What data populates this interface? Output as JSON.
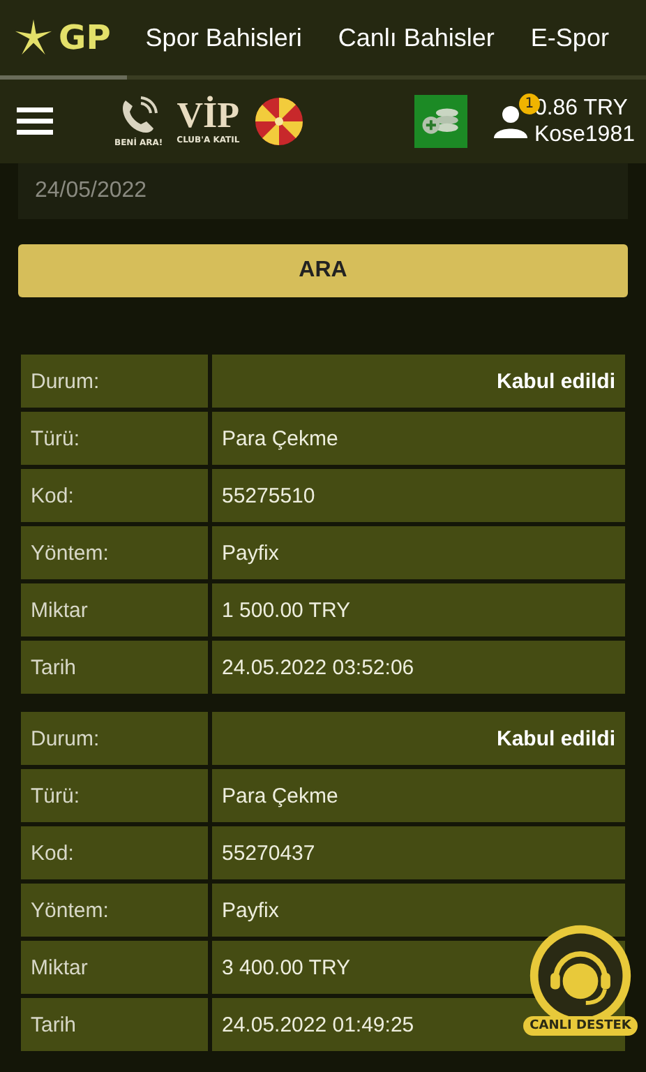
{
  "nav": {
    "logo": "GP",
    "tabs": [
      {
        "label": "Spor Bahisleri",
        "selected": false
      },
      {
        "label": "Canlı Bahisler",
        "selected": false
      },
      {
        "label": "E-Spor",
        "selected": false
      }
    ],
    "logo_selected": true
  },
  "header": {
    "call_label": "BENİ ARA!",
    "vip_label": "VİP",
    "vip_caption": "CLUB'A KATIL",
    "notification_count": "1",
    "balance": "0.86 TRY",
    "username": "Kose1981"
  },
  "date_field": {
    "value": "24/05/2022"
  },
  "search_button": "ARA",
  "records": [
    {
      "rows": [
        {
          "kind": "status",
          "label": "Durum:",
          "value": "Kabul edildi"
        },
        {
          "kind": "plain",
          "label": "Türü:",
          "value": "Para Çekme"
        },
        {
          "kind": "plain",
          "label": "Kod:",
          "value": "55275510"
        },
        {
          "kind": "plain",
          "label": "Yöntem:",
          "value": "Payfix"
        },
        {
          "kind": "plain",
          "label": "Miktar",
          "value": "1 500.00 TRY"
        },
        {
          "kind": "plain",
          "label": "Tarih",
          "value": "24.05.2022 03:52:06"
        }
      ]
    },
    {
      "rows": [
        {
          "kind": "status",
          "label": "Durum:",
          "value": "Kabul edildi"
        },
        {
          "kind": "plain",
          "label": "Türü:",
          "value": "Para Çekme"
        },
        {
          "kind": "plain",
          "label": "Kod:",
          "value": "55270437"
        },
        {
          "kind": "plain",
          "label": "Yöntem:",
          "value": "Payfix"
        },
        {
          "kind": "plain",
          "label": "Miktar",
          "value": "3 400.00 TRY"
        },
        {
          "kind": "plain",
          "label": "Tarih",
          "value": "24.05.2022 01:49:25"
        }
      ]
    }
  ],
  "support": {
    "label": "CANLI DESTEK"
  }
}
